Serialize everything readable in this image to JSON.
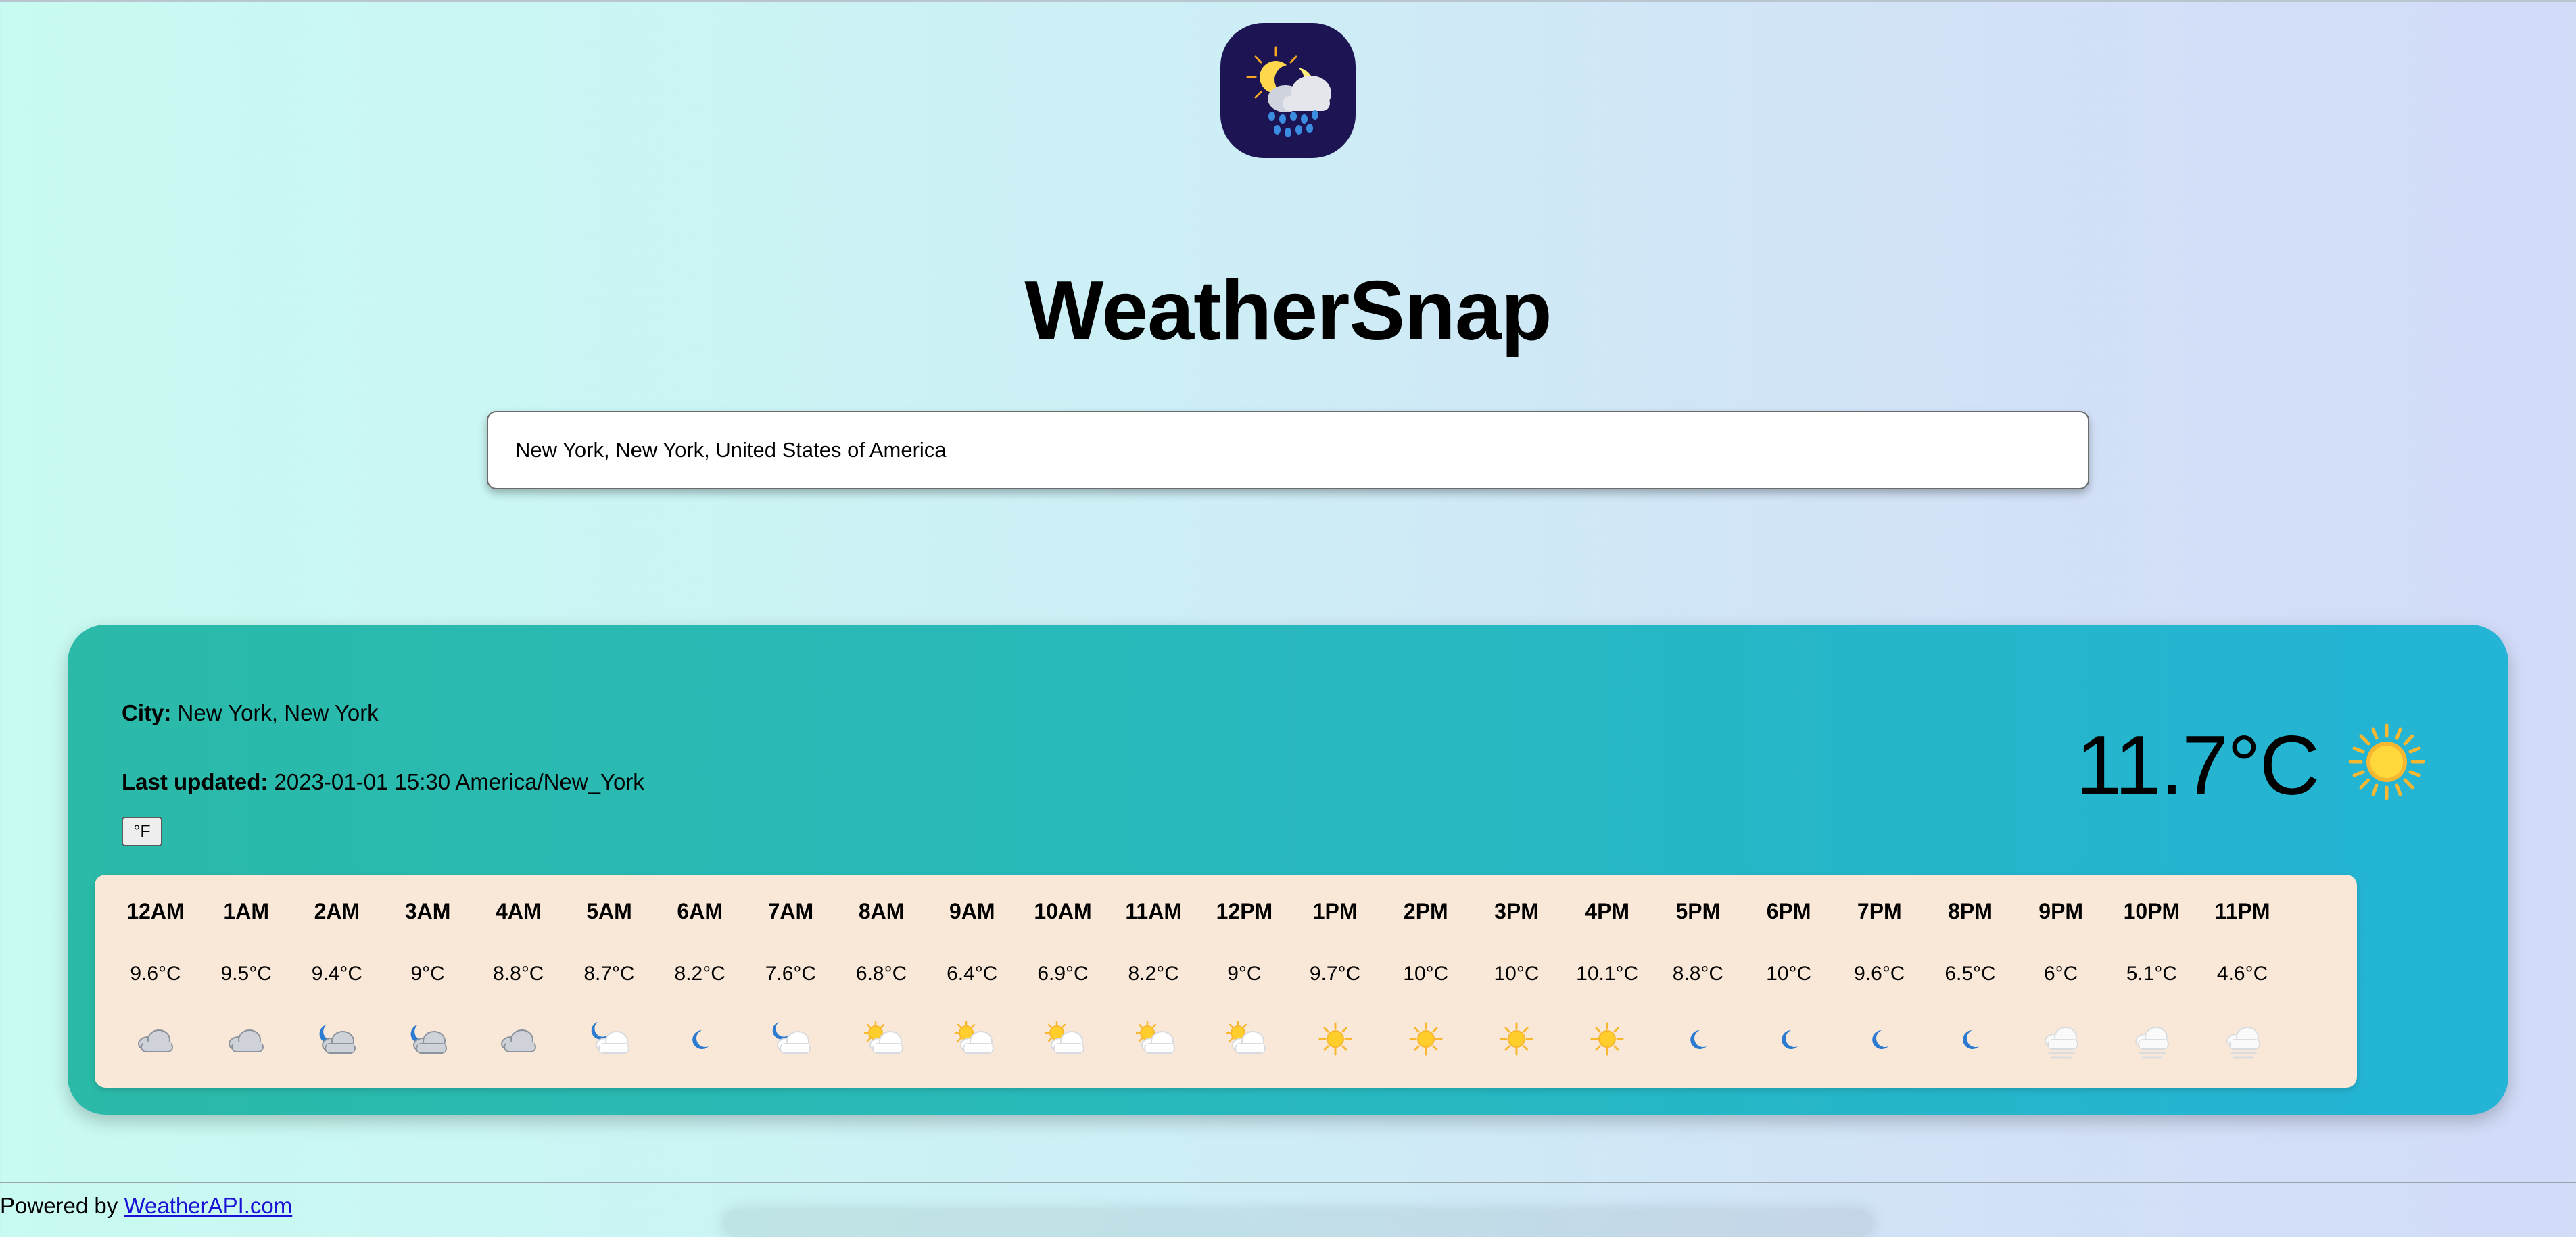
{
  "app": {
    "title": "WeatherSnap",
    "logo_icon": "sun-moon-cloud-rain-icon",
    "logo_bg": "#1c1453"
  },
  "search": {
    "value": "New York, New York, United States of America"
  },
  "current": {
    "city_label": "City:",
    "city_value": "New York, New York",
    "updated_label": "Last updated:",
    "updated_value": "2023-01-01 15:30 America/New_York",
    "unit_toggle_label": "°F",
    "temperature": "11.7°C",
    "icon": "sun-icon"
  },
  "hourly": [
    {
      "time": "12AM",
      "temp": "9.6°C",
      "icon": "cloud"
    },
    {
      "time": "1AM",
      "temp": "9.5°C",
      "icon": "cloud"
    },
    {
      "time": "2AM",
      "temp": "9.4°C",
      "icon": "moon-cloud"
    },
    {
      "time": "3AM",
      "temp": "9°C",
      "icon": "moon-cloud"
    },
    {
      "time": "4AM",
      "temp": "8.8°C",
      "icon": "cloud"
    },
    {
      "time": "5AM",
      "temp": "8.7°C",
      "icon": "moon-cloud-white"
    },
    {
      "time": "6AM",
      "temp": "8.2°C",
      "icon": "moon"
    },
    {
      "time": "7AM",
      "temp": "7.6°C",
      "icon": "moon-cloud-white"
    },
    {
      "time": "8AM",
      "temp": "6.8°C",
      "icon": "sun-cloud"
    },
    {
      "time": "9AM",
      "temp": "6.4°C",
      "icon": "sun-cloud"
    },
    {
      "time": "10AM",
      "temp": "6.9°C",
      "icon": "sun-cloud"
    },
    {
      "time": "11AM",
      "temp": "8.2°C",
      "icon": "sun-cloud"
    },
    {
      "time": "12PM",
      "temp": "9°C",
      "icon": "sun-cloud"
    },
    {
      "time": "1PM",
      "temp": "9.7°C",
      "icon": "sun"
    },
    {
      "time": "2PM",
      "temp": "10°C",
      "icon": "sun"
    },
    {
      "time": "3PM",
      "temp": "10°C",
      "icon": "sun"
    },
    {
      "time": "4PM",
      "temp": "10.1°C",
      "icon": "sun"
    },
    {
      "time": "5PM",
      "temp": "8.8°C",
      "icon": "moon"
    },
    {
      "time": "6PM",
      "temp": "10°C",
      "icon": "moon"
    },
    {
      "time": "7PM",
      "temp": "9.6°C",
      "icon": "moon"
    },
    {
      "time": "8PM",
      "temp": "6.5°C",
      "icon": "moon"
    },
    {
      "time": "9PM",
      "temp": "6°C",
      "icon": "fog"
    },
    {
      "time": "10PM",
      "temp": "5.1°C",
      "icon": "fog"
    },
    {
      "time": "11PM",
      "temp": "4.6°C",
      "icon": "fog"
    }
  ],
  "footer": {
    "prefix": "Powered by",
    "link_text": "WeatherAPI.com"
  },
  "colors": {
    "card_start": "#2bbaa8",
    "card_end": "#24b4d6",
    "forecast_bg": "#f9e8d7",
    "link": "#1a10d6"
  }
}
